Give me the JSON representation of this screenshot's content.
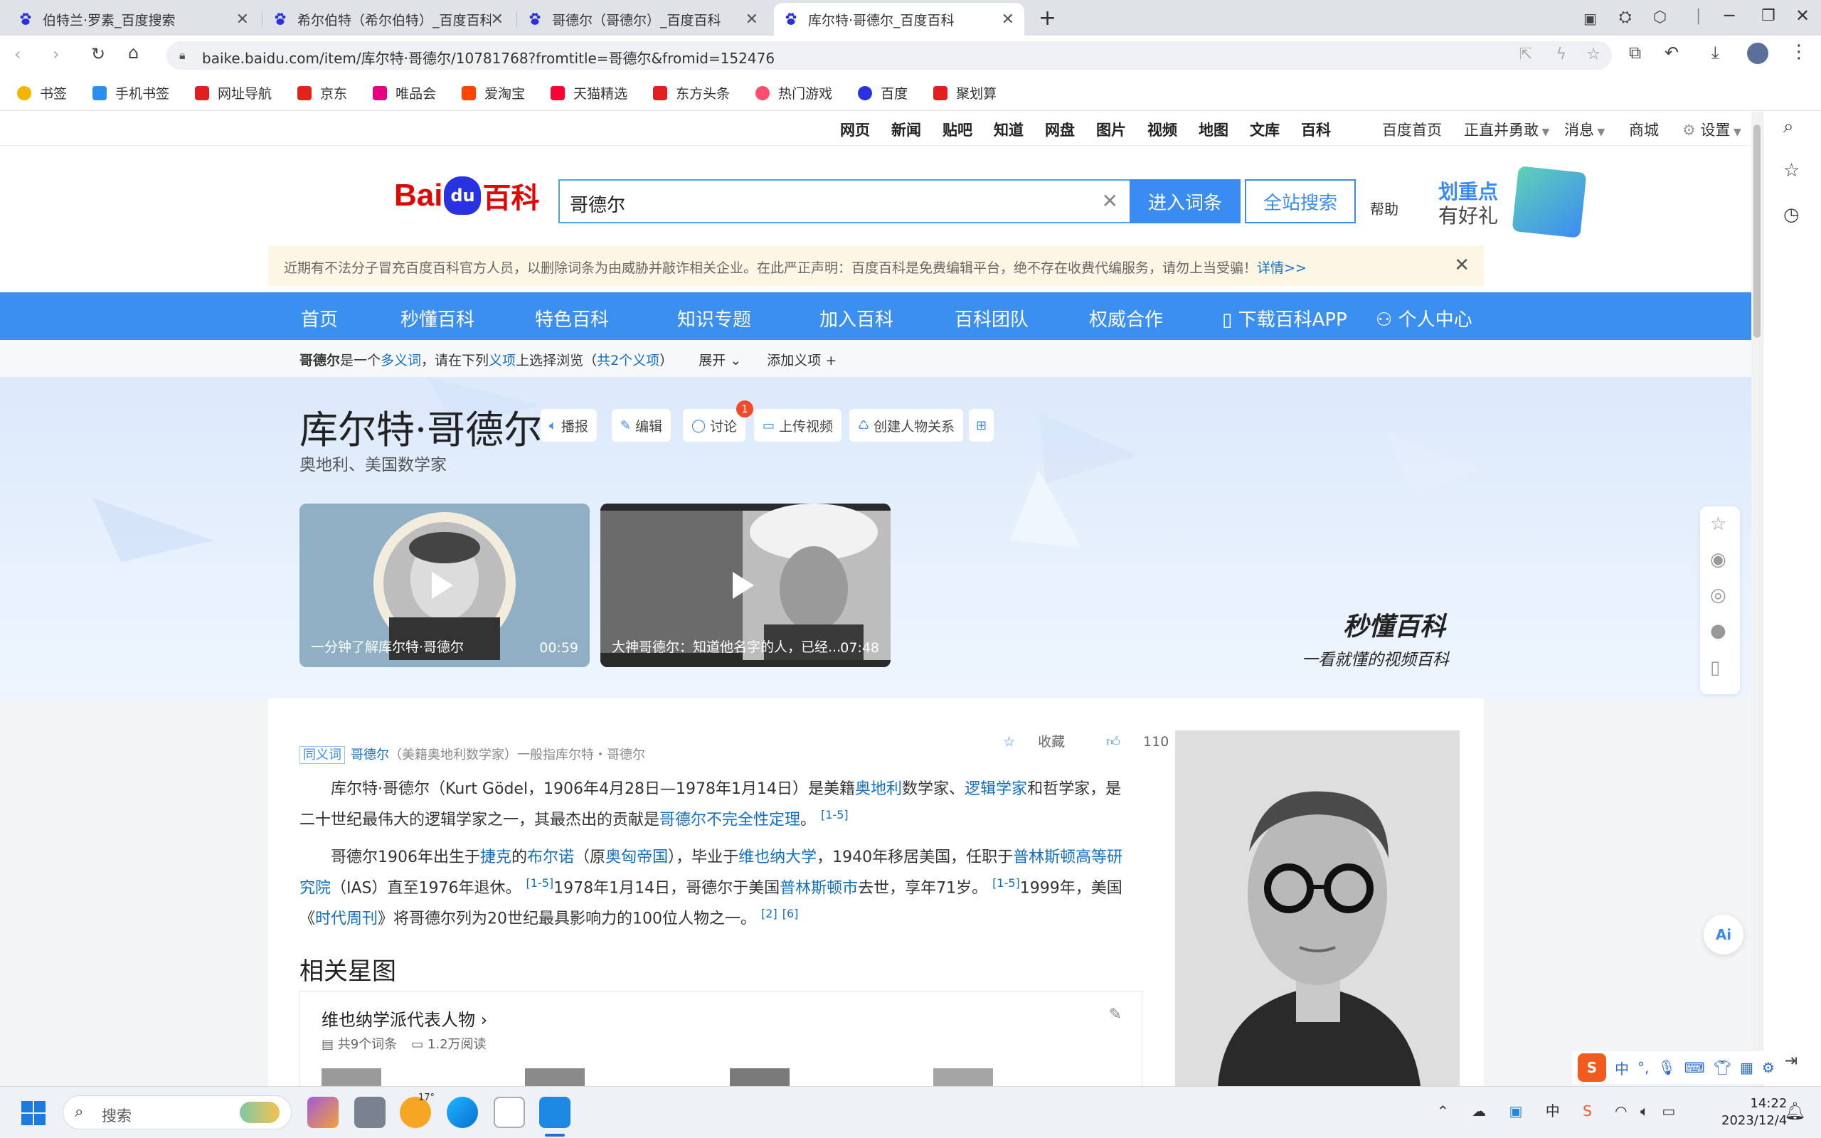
{
  "tabs": [
    {
      "title": "伯特兰·罗素_百度搜索",
      "active": false
    },
    {
      "title": "希尔伯特（希尔伯特）_百度百科",
      "active": false
    },
    {
      "title": "哥德尔（哥德尔）_百度百科",
      "active": false
    },
    {
      "title": "库尔特·哥德尔_百度百科",
      "active": true
    }
  ],
  "address": {
    "url": "baike.baidu.com/item/库尔特·哥德尔/10781768?fromtitle=哥德尔&fromid=152476"
  },
  "bookmarks": [
    {
      "label": "书签",
      "color": "#f5b400"
    },
    {
      "label": "手机书签",
      "color": "#2b8ef0"
    },
    {
      "label": "网址导航",
      "color": "#e02020"
    },
    {
      "label": "京东",
      "color": "#e1251b"
    },
    {
      "label": "唯品会",
      "color": "#e4007f"
    },
    {
      "label": "爱淘宝",
      "color": "#ff4400"
    },
    {
      "label": "天猫精选",
      "color": "#ff0036"
    },
    {
      "label": "东方头条",
      "color": "#e02020"
    },
    {
      "label": "热门游戏",
      "color": "#ff4d6d"
    },
    {
      "label": "百度",
      "color": "#2932e1"
    },
    {
      "label": "聚划算",
      "color": "#e02020"
    }
  ],
  "topnav": {
    "links": [
      "网页",
      "新闻",
      "贴吧",
      "知道",
      "网盘",
      "图片",
      "视频",
      "地图",
      "文库",
      "百科"
    ],
    "right": [
      "百度首页",
      "正直并勇敢",
      "消息",
      "商城",
      "设置"
    ]
  },
  "logo": {
    "bai": "Bai",
    "du": "du",
    "baike": "百科"
  },
  "search": {
    "value": "哥德尔",
    "enter": "进入词条",
    "all": "全站搜索",
    "help": "帮助"
  },
  "promo": {
    "line1": "划重点",
    "line2": "有好礼"
  },
  "notice": {
    "text": "近期有不法分子冒充百度百科官方人员，以删除词条为由威胁并敲诈相关企业。在此严正声明：百度百科是免费编辑平台，绝不存在收费代编服务，请勿上当受骗！",
    "more": "详情>>"
  },
  "bluenav": [
    "首页",
    "秒懂百科",
    "特色百科",
    "知识专题",
    "加入百科",
    "百科团队",
    "权威合作",
    "下载百科APP",
    "个人中心"
  ],
  "polysemy": {
    "term": "哥德尔",
    "t1": "是一个",
    "link1": "多义词",
    "t2": "，请在下列",
    "link2": "义项",
    "t3": "上选择浏览（",
    "link3": "共2个义项",
    "t4": "）",
    "expand": "展开",
    "add": "添加义项"
  },
  "entry": {
    "title": "库尔特·哥德尔",
    "subtitle": "奥地利、美国数学家"
  },
  "entry_actions": [
    "播报",
    "编辑",
    "讨论",
    "上传视频",
    "创建人物关系"
  ],
  "discuss_badge": "1",
  "videos": [
    {
      "caption": "一分钟了解库尔特·哥德尔",
      "duration": "00:59"
    },
    {
      "caption": "大神哥德尔：知道他名字的人，已经...",
      "duration": "07:48"
    }
  ],
  "miaodong": {
    "brand": "秒懂百科",
    "slogan": "一看就懂的视频百科"
  },
  "synonym": {
    "tag": "同义词",
    "link": "哥德尔",
    "text": "（美籍奥地利数学家）一般指库尔特・哥德尔"
  },
  "stats": {
    "collect": "收藏",
    "likes": "110",
    "shares": "18"
  },
  "summary": {
    "p1a": "库尔特·哥德尔（Kurt Gödel，1906年4月28日—1978年1月14日）是美籍",
    "p1l1": "奥地利",
    "p1b": "数学家、",
    "p1l2": "逻辑学家",
    "p1c": "和哲学家，是二十世纪最伟大的逻辑学家之一，其最杰出的贡献是",
    "p1l3": "哥德尔不完全性定理",
    "p1d": "。",
    "p1s": "[1-5]",
    "p2a": "哥德尔1906年出生于",
    "p2l1": "捷克",
    "p2b": "的",
    "p2l2": "布尔诺",
    "p2c": "（原",
    "p2l3": "奥匈帝国",
    "p2d": "），毕业于",
    "p2l4": "维也纳大学",
    "p2e": "，1940年移居美国，任职于",
    "p2l5": "普林斯顿高等研究院",
    "p2f": "（IAS）直至1976年退休。",
    "p2s1": "[1-5]",
    "p2g": "1978年1月14日，哥德尔于美国",
    "p2l6": "普林斯顿市",
    "p2h": "去世，享年71岁。",
    "p2s2": "[1-5]",
    "p2i": "1999年，美国《",
    "p2l7": "时代周刊",
    "p2j": "》将哥德尔列为20世纪最具影响力的100位人物之一。",
    "p2s3": "[2]",
    "p2s4": "[6]"
  },
  "related": {
    "heading": "相关星图",
    "card_title": "维也纳学派代表人物",
    "count": "共9个词条",
    "reads": "1.2万阅读"
  },
  "ime": {
    "lang": "中"
  },
  "taskbar": {
    "search_placeholder": "搜索",
    "weather": "17°",
    "lang": "中",
    "time": "14:22",
    "date": "2023/12/4"
  }
}
